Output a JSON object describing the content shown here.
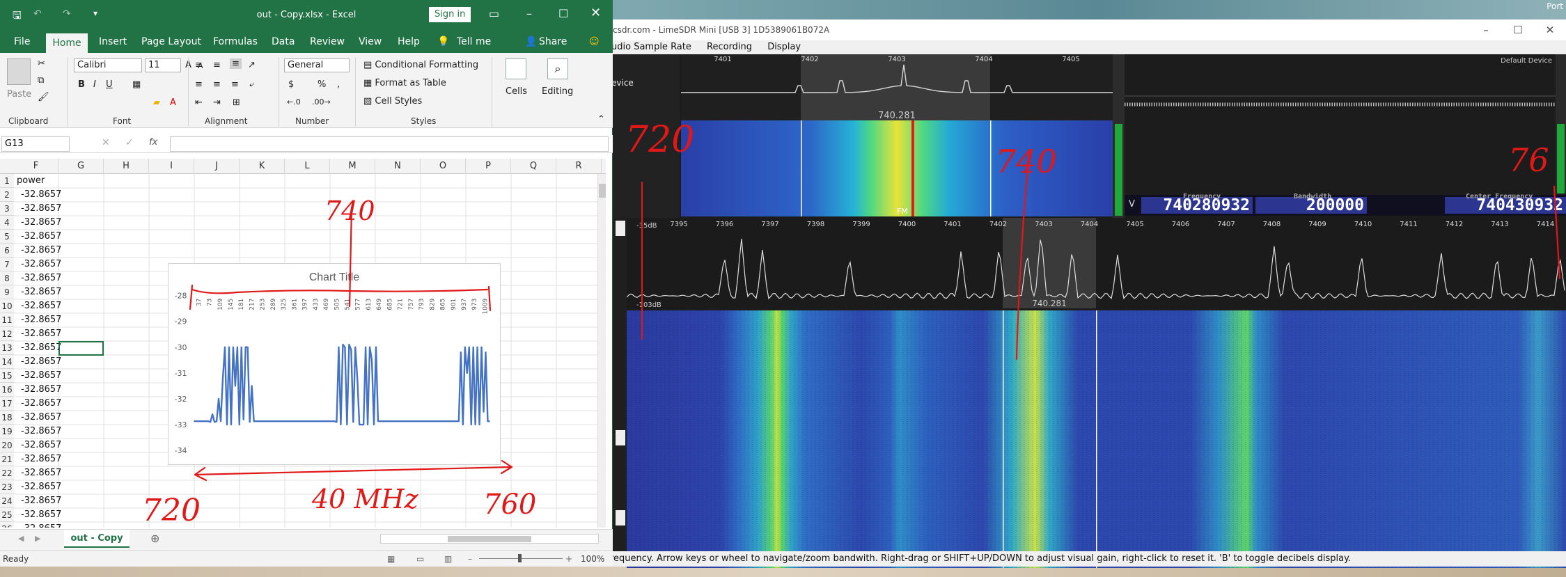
{
  "desktop": {
    "corner_text": "Port"
  },
  "sdr": {
    "title": "csdr.com - LimeSDR Mini [USB 3] 1D5389061B072A",
    "menu": [
      "udio Sample Rate",
      "Recording",
      "Display"
    ],
    "device_tab": "evice",
    "default_device": "Default Device",
    "spec1_ticks": [
      "7401",
      "7402",
      "7403",
      "7404",
      "7405"
    ],
    "spec1_center": "740.281",
    "fm_label": "FM",
    "v_label": "V",
    "freq_label": "Frequency",
    "freq_value": "740280932",
    "bw_label": "Bandwidth",
    "bw_value": "200000",
    "cf_label": "Center Frequency",
    "cf_value": "740430932",
    "spec2_ticks": [
      "7395",
      "7396",
      "7397",
      "7398",
      "7399",
      "7400",
      "7401",
      "7402",
      "7403",
      "7404",
      "7405",
      "7406",
      "7407",
      "7408",
      "7409",
      "7410",
      "7411",
      "7412",
      "7413",
      "7414"
    ],
    "db_top": "-35dB",
    "db_bottom": "-103dB",
    "spec2_center": "740.281",
    "wf2_label": "FM",
    "status": "requency. Arrow keys or wheel to navigate/zoom bandwith. Right-drag or SHIFT+UP/DOWN to adjust visual gain, right-click to reset it. 'B' to toggle decibels display."
  },
  "excel": {
    "title": "out - Copy.xlsx  -  Excel",
    "signin": "Sign in",
    "tabs": [
      "File",
      "Home",
      "Insert",
      "Page Layout",
      "Formulas",
      "Data",
      "Review",
      "View",
      "Help"
    ],
    "tellme": "Tell me",
    "share": "Share",
    "ribbon": {
      "paste": "Paste",
      "clipboard": "Clipboard",
      "font_name": "Calibri",
      "font_size": "11",
      "font": "Font",
      "alignment": "Alignment",
      "number_format": "General",
      "number": "Number",
      "cond_format": "Conditional Formatting",
      "format_table": "Format as Table",
      "cell_styles": "Cell Styles",
      "styles": "Styles",
      "cells": "Cells",
      "editing": "Editing"
    },
    "namebox": "G13",
    "columns": [
      "F",
      "G",
      "H",
      "I",
      "J",
      "K",
      "L",
      "M",
      "N",
      "O",
      "P",
      "Q",
      "R"
    ],
    "rows": [
      "1",
      "2",
      "3",
      "4",
      "5",
      "6",
      "7",
      "8",
      "9",
      "10",
      "11",
      "12",
      "13",
      "14",
      "15",
      "16",
      "17",
      "18",
      "19",
      "20",
      "21",
      "22",
      "23",
      "24",
      "25",
      "26"
    ],
    "f_values": [
      "power",
      "-32.8657",
      "-32.8657",
      "-32.8657",
      "-32.8657",
      "-32.8657",
      "-32.8657",
      "-32.8657",
      "-32.8657",
      "-32.8657",
      "-32.8657",
      "-32.8657",
      "-32.8657",
      "-32.8657",
      "-32.8657",
      "-32.8657",
      "-32.8657",
      "-32.8657",
      "-32.8657",
      "-32.8657",
      "-32.8657",
      "-32.8657",
      "-32.8657",
      "-32.8657",
      "-32.8657",
      "-32.8657"
    ],
    "sheet_tab": "out - Copy",
    "status_ready": "Ready",
    "zoom": "100%"
  },
  "chart_data": {
    "type": "line",
    "title": "Chart Title",
    "ylim": [
      -34,
      -28
    ],
    "yticks": [
      "-28",
      "-29",
      "-30",
      "-31",
      "-32",
      "-33",
      "-34"
    ],
    "categories": [
      "37",
      "73",
      "109",
      "145",
      "181",
      "217",
      "253",
      "289",
      "325",
      "361",
      "397",
      "433",
      "469",
      "505",
      "541",
      "577",
      "613",
      "649",
      "685",
      "721",
      "757",
      "793",
      "829",
      "865",
      "901",
      "937",
      "973",
      "1009"
    ],
    "series": [
      {
        "color": "#4472c4",
        "values": [
          -32.87,
          -32.87,
          -32.87,
          -32.87,
          -32.87,
          -32.87,
          -32.87,
          -32.87,
          -32.9,
          -32.6,
          -32.9,
          -32.87,
          -32.0,
          -32.87,
          -31.2,
          -30.0,
          -33.0,
          -30.0,
          -33.0,
          -30.0,
          -31.5,
          -30.0,
          -33.0,
          -30.0,
          -32.8,
          -30.0,
          -30.0,
          -32.9,
          -31.5,
          -32.87,
          -32.87,
          -32.87,
          -32.87,
          -32.87,
          -32.87,
          -32.87,
          -32.87,
          -32.87,
          -32.87,
          -32.87,
          -32.87,
          -32.87,
          -32.87,
          -32.87,
          -32.87,
          -32.87,
          -32.87,
          -32.87,
          -32.87,
          -32.87,
          -32.87,
          -32.87,
          -32.87,
          -32.87,
          -32.87,
          -32.87,
          -32.87,
          -32.87,
          -32.87,
          -32.87,
          -32.87,
          -32.87,
          -32.87,
          -32.87,
          -32.87,
          -32.87,
          -32.87,
          -32.87,
          -32.87,
          -32.9,
          -30.0,
          -33.0,
          -29.9,
          -30.0,
          -33.0,
          -29.9,
          -30.1,
          -32.9,
          -30.0,
          -31.2,
          -33.0,
          -33.0,
          -33.0,
          -30.0,
          -33.0,
          -30.0,
          -30.5,
          -33.0,
          -30.0,
          -32.87,
          -32.87,
          -32.87,
          -32.87,
          -32.87,
          -32.87,
          -32.87,
          -32.87,
          -32.87,
          -32.87,
          -32.87,
          -32.87,
          -32.87,
          -32.87,
          -32.87,
          -32.87,
          -32.87,
          -32.87,
          -32.87,
          -32.87,
          -32.87,
          -32.87,
          -32.87,
          -32.87,
          -32.87,
          -32.87,
          -32.87,
          -32.87,
          -32.87,
          -32.87,
          -32.87,
          -32.87,
          -32.87,
          -32.87,
          -32.87,
          -32.87,
          -32.87,
          -32.87,
          -32.87,
          -32.87,
          -30.2,
          -33.0,
          -30.0,
          -31.0,
          -30.0,
          -33.0,
          -30.0,
          -33.0,
          -30.0,
          -33.0,
          -30.0,
          -32.5,
          -30.2,
          -32.87,
          -32.87
        ]
      }
    ]
  },
  "annotations": {
    "a740": "740",
    "a720": "720",
    "a40": "40 MHz",
    "a760": "760",
    "a720r": "720",
    "a740r": "740",
    "a76r": "76"
  }
}
